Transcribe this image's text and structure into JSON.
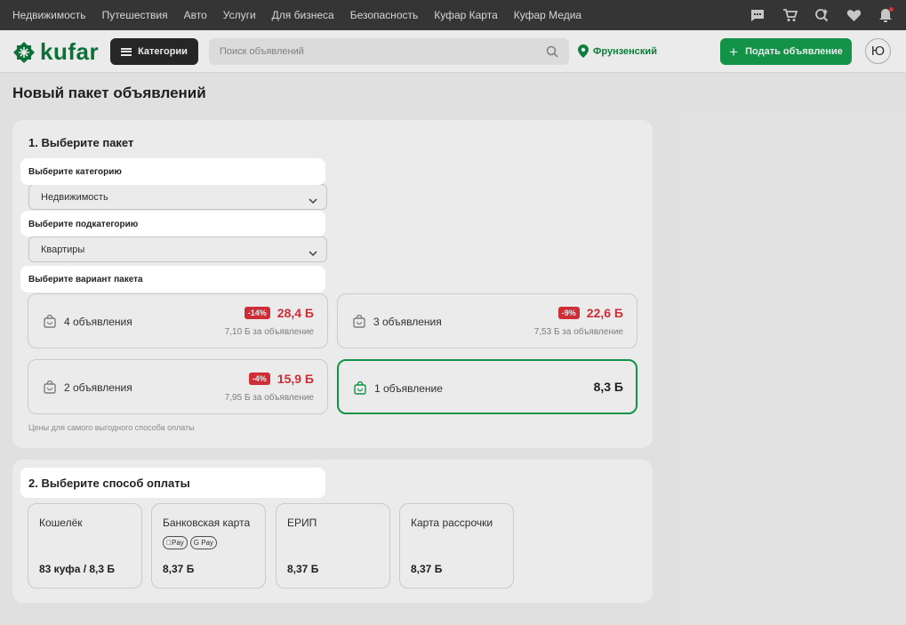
{
  "topnav": {
    "links": [
      "Недвижимость",
      "Путешествия",
      "Авто",
      "Услуги",
      "Для бизнеса",
      "Безопасность",
      "Куфар Карта",
      "Куфар Медиа"
    ],
    "icons": [
      "chat-icon",
      "cart-icon",
      "saved-search-icon",
      "heart-icon",
      "bell-icon"
    ]
  },
  "header": {
    "logo": "kufar",
    "categories_label": "Категории",
    "search_placeholder": "Поиск объявлений",
    "location": "Фрунзенский",
    "post_label": "Подать объявление",
    "avatar_initial": "Ю"
  },
  "page_title": "Новый пакет объявлений",
  "step1": {
    "title": "1. Выберите пакет",
    "category_label": "Выберите категорию",
    "category_value": "Недвижимость",
    "subcategory_label": "Выберите подкатегорию",
    "subcategory_value": "Квартиры",
    "variant_label": "Выберите вариант пакета",
    "packages": [
      {
        "name": "4 объявления",
        "discount": "-14%",
        "price": "28,4 Б",
        "per": "7,10 Б за объявление"
      },
      {
        "name": "3 объявления",
        "discount": "-9%",
        "price": "22,6 Б",
        "per": "7,53 Б за объявление"
      },
      {
        "name": "2 объявления",
        "discount": "-4%",
        "price": "15,9 Б",
        "per": "7,95 Б за объявление"
      },
      {
        "name": "1 объявление",
        "price": "8,3 Б"
      }
    ],
    "note": "Цены для самого выгодного способа оплаты"
  },
  "step2": {
    "title": "2. Выберите способ оплаты",
    "methods": [
      {
        "name": "Кошелёк",
        "price": "83 куфа / 8,3 Б"
      },
      {
        "name": "Банковская карта",
        "price": "8,37 Б",
        "chips": [
          "Pay",
          "G Pay"
        ]
      },
      {
        "name": "ЕРИП",
        "price": "8,37 Б"
      },
      {
        "name": "Карта рассрочки",
        "price": "8,37 Б"
      }
    ]
  },
  "colors": {
    "brand_green": "#0c7a3c",
    "button_green": "#14a04f",
    "discount_red": "#e0303c",
    "topbar": "#3a3a3a"
  }
}
